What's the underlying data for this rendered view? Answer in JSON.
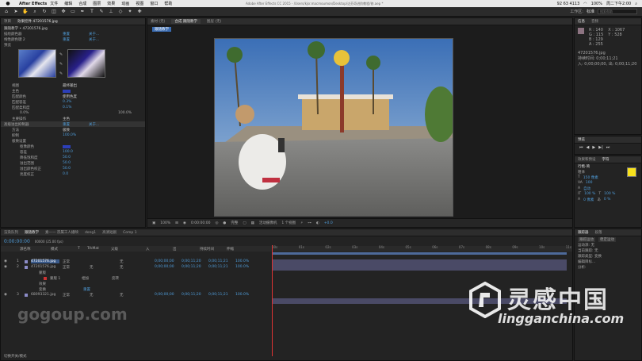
{
  "menubar": {
    "app": "After Effects",
    "items": [
      "文件",
      "编辑",
      "合成",
      "图层",
      "效果",
      "动画",
      "视图",
      "窗口",
      "帮助"
    ],
    "window_title": "Adobe After Effects CC 2015 - /Users/kjsr.macmoumon/Desktop/达芬奇进阶教程/修.aep *",
    "status": [
      "92 63 4113",
      "100%",
      "周二下午2:00"
    ]
  },
  "toolbar": {
    "workspace_label": "工作区:",
    "workspace_value": "标准",
    "search_placeholder": "搜索帮助"
  },
  "effects_panel": {
    "tabs": [
      "项目",
      "效果控件 47201576.jpg"
    ],
    "layer_title": "跟随教学 • 47201576.jpg",
    "rows": [
      {
        "label": "描绘颜色器",
        "value": "重置",
        "extra": "关于..."
      },
      {
        "label": "线性颜色键 2",
        "value": "重置",
        "extra": "关于..."
      },
      {
        "label": "预览",
        "value": ""
      },
      {
        "label": "视图",
        "value": "最终输出"
      },
      {
        "label": "主色",
        "value": ""
      },
      {
        "label": "匹配颜色",
        "value": "使用色度"
      },
      {
        "label": "匹配容差",
        "value": "0.3%"
      },
      {
        "label": "匹配柔和度",
        "value": "0.1%"
      },
      {
        "label": "0.0%",
        "value": "100.0%"
      },
      {
        "label": "主要操作",
        "value": "主色"
      },
      {
        "label": "高级溢出抑制器",
        "value": "重置",
        "extra": "关于..."
      },
      {
        "label": "方法",
        "value": "极致"
      },
      {
        "label": "抑制",
        "value": "100.0%"
      },
      {
        "label": "极致设置",
        "value": ""
      },
      {
        "label": "抠像颜色",
        "value": ""
      },
      {
        "label": "容差",
        "value": "100.0"
      },
      {
        "label": "降低饱和度",
        "value": "50.0"
      },
      {
        "label": "溢出范围",
        "value": "50.0"
      },
      {
        "label": "溢出颜色校正",
        "value": "50.0"
      },
      {
        "label": "亮度校正",
        "value": "0.0"
      }
    ]
  },
  "comp_panel": {
    "tabs": [
      "素材 (无)",
      "合成 跟随教学",
      "图层 (无)"
    ],
    "breadcrumb": "跟随教学",
    "zoom": "100%",
    "timecode": "0:00:00:00",
    "quality": "完整",
    "camera": "活动摄像机",
    "views": "1 个视图",
    "exposure": "+0.0"
  },
  "info_panel": {
    "tabs": [
      "信息",
      "音频"
    ],
    "rgb": [
      "R : 140",
      "G : 115",
      "B : 129",
      "A : 255"
    ],
    "coords": [
      "X : 1067",
      "Y : 528"
    ],
    "file": "47201576.jpg",
    "duration": "持续时间: 0;00;11;21",
    "in_out": "入: 0;00;00;00, 出: 0;00;11;20"
  },
  "preview_panel": {
    "title": "预览"
  },
  "character_panel": {
    "tabs": [
      "效果和预设",
      "字符"
    ],
    "font": "行楷-简",
    "style": "粗体",
    "size": "150 像素",
    "tracking": "100",
    "leading": "自动",
    "scale_v": "100 %",
    "scale_h": "100 %",
    "baseline": "0 像素",
    "tsume": "0 %"
  },
  "timeline": {
    "tabs": [
      "渲染队列",
      "跟随教学",
      "素—— 宗属工人播映",
      "dong1",
      "高清短剧",
      "Comp 1"
    ],
    "timecode": "0:00:00:00",
    "fps": "00000 (25.00 fps)",
    "columns": [
      "源名称",
      "模式",
      "T",
      "TrkMat",
      "父级",
      "入",
      "出",
      "持续时间",
      "伸缩"
    ],
    "layers": [
      {
        "index": "1",
        "name": "47201576.jpg",
        "mode": "正常",
        "trk": "",
        "parent": "无",
        "in": "0;00;00;00",
        "out": "0;00;11;20",
        "dur": "0;00;11;21",
        "stretch": "100.0%"
      },
      {
        "index": "2",
        "name": "47201576.jpg",
        "mode": "正常",
        "trk": "无",
        "parent": "无",
        "in": "0;00;00;00",
        "out": "0;00;11;20",
        "dur": "0;00;11;21",
        "stretch": "100.0%"
      },
      {
        "index": "",
        "name": "蒙版",
        "mode": "",
        "trk": "",
        "parent": "",
        "in": "",
        "out": "",
        "dur": "",
        "stretch": ""
      },
      {
        "index": "",
        "name": "蒙版 1",
        "mode": "相加",
        "trk": "",
        "parent": "反转",
        "in": "",
        "out": "",
        "dur": "",
        "stretch": ""
      },
      {
        "index": "",
        "name": "效果",
        "mode": "",
        "trk": "",
        "parent": "",
        "in": "",
        "out": "",
        "dur": "",
        "stretch": ""
      },
      {
        "index": "",
        "name": "变换",
        "mode": "重置",
        "trk": "",
        "parent": "",
        "in": "",
        "out": "",
        "dur": "",
        "stretch": ""
      },
      {
        "index": "3",
        "name": "68093321.jpg",
        "mode": "正常",
        "trk": "无",
        "parent": "无",
        "in": "0;00;00;00",
        "out": "0;00;11;20",
        "dur": "0;00;11;21",
        "stretch": "100.0%"
      }
    ],
    "ruler": [
      "00s",
      "01s",
      "02s",
      "03s",
      "04s",
      "05s",
      "06s",
      "07s",
      "08s",
      "09s",
      "10s",
      "11s"
    ],
    "footer": "切换开关/模式"
  },
  "paragraph_panel": {
    "tabs": [
      "跟踪器",
      "段落"
    ],
    "rows": [
      "运动源: 无",
      "当前跟踪: 无",
      "跟踪类型: 变换",
      "编辑目标..."
    ],
    "buttons": [
      "跟踪运动",
      "稳定运动",
      "分析:"
    ]
  },
  "watermarks": {
    "logo_text": "灵感中国",
    "logo_sub": "lingganchina.com",
    "left": "gogoup.com"
  }
}
